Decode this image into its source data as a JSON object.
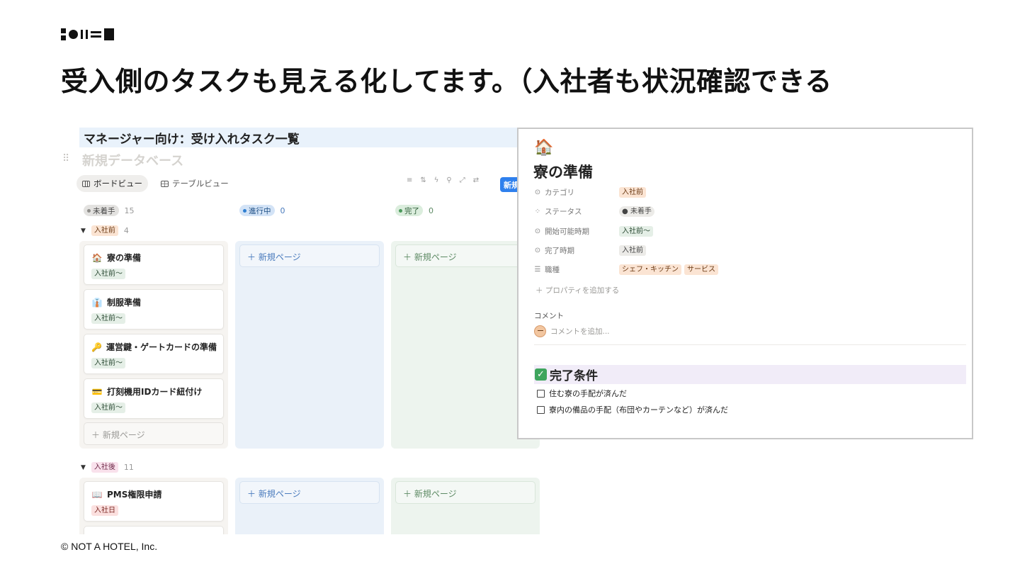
{
  "slide": {
    "title": "受入側のタスクも見える化してます。（入社者も状況確認できる",
    "footer": "© NOT A HOTEL, Inc."
  },
  "board": {
    "db_heading": "マネージャー向け：受け入れタスク一覧",
    "db_name": "新規データベース",
    "views": [
      {
        "label": "ボードビュー",
        "icon": "board-view-icon",
        "active": true
      },
      {
        "label": "テーブルビュー",
        "icon": "table-view-icon",
        "active": false
      }
    ],
    "new_button": "新規",
    "columns": [
      {
        "label": "未着手",
        "count": "15",
        "color": "#f6f4f1",
        "pill_bg": "#e3e2e0",
        "dot": "#8f8e8a"
      },
      {
        "label": "進行中",
        "count": "0",
        "color": "#eaf1f9",
        "pill_bg": "#d3e3f6",
        "dot": "#2f7fd1"
      },
      {
        "label": "完了",
        "count": "0",
        "color": "#edf4ee",
        "pill_bg": "#dbeddd",
        "dot": "#4c9a5c"
      }
    ],
    "groups": [
      {
        "label": "入社前",
        "count": "4",
        "cards": [
          {
            "title": "寮の準備",
            "emoji": "🏠",
            "tag": "入社前〜"
          },
          {
            "title": "制服準備",
            "emoji": "👔",
            "tag": "入社前〜"
          },
          {
            "title": "運営鍵・ゲートカードの準備",
            "emoji": "🔑",
            "tag": "入社前〜"
          },
          {
            "title": "打刻機用IDカード紐付け",
            "emoji": "💳",
            "tag": "入社前〜"
          }
        ]
      },
      {
        "label": "入社後",
        "count": "11",
        "cards": [
          {
            "title": "PMS権限申請",
            "emoji": "📖",
            "tag": "入社日"
          }
        ]
      }
    ],
    "new_page_label": "＋ 新規ページ"
  },
  "detail": {
    "emoji": "🏠",
    "title": "寮の準備",
    "properties": [
      {
        "key": "カテゴリ",
        "icon": "select-icon",
        "values": [
          {
            "text": "入社前",
            "style": "orange"
          }
        ]
      },
      {
        "key": "ステータス",
        "icon": "status-icon",
        "values": [
          {
            "text": "● 未着手",
            "style": "gray"
          }
        ]
      },
      {
        "key": "開始可能時期",
        "icon": "select-icon",
        "values": [
          {
            "text": "入社前〜",
            "style": "green"
          }
        ]
      },
      {
        "key": "完了時期",
        "icon": "select-icon",
        "values": [
          {
            "text": "入社前",
            "style": "gray"
          }
        ]
      },
      {
        "key": "職種",
        "icon": "list-icon",
        "values": [
          {
            "text": "シェフ・キッチン",
            "style": "orange"
          },
          {
            "text": "サービス",
            "style": "orange"
          }
        ]
      }
    ],
    "add_property": "＋ プロパティを追加する",
    "comment_label": "コメント",
    "comment_placeholder": "コメントを追加...",
    "done_heading": "完了条件",
    "todos": [
      "住む寮の手配が済んだ",
      "寮内の備品の手配（布団やカーテンなど）が済んだ"
    ]
  }
}
